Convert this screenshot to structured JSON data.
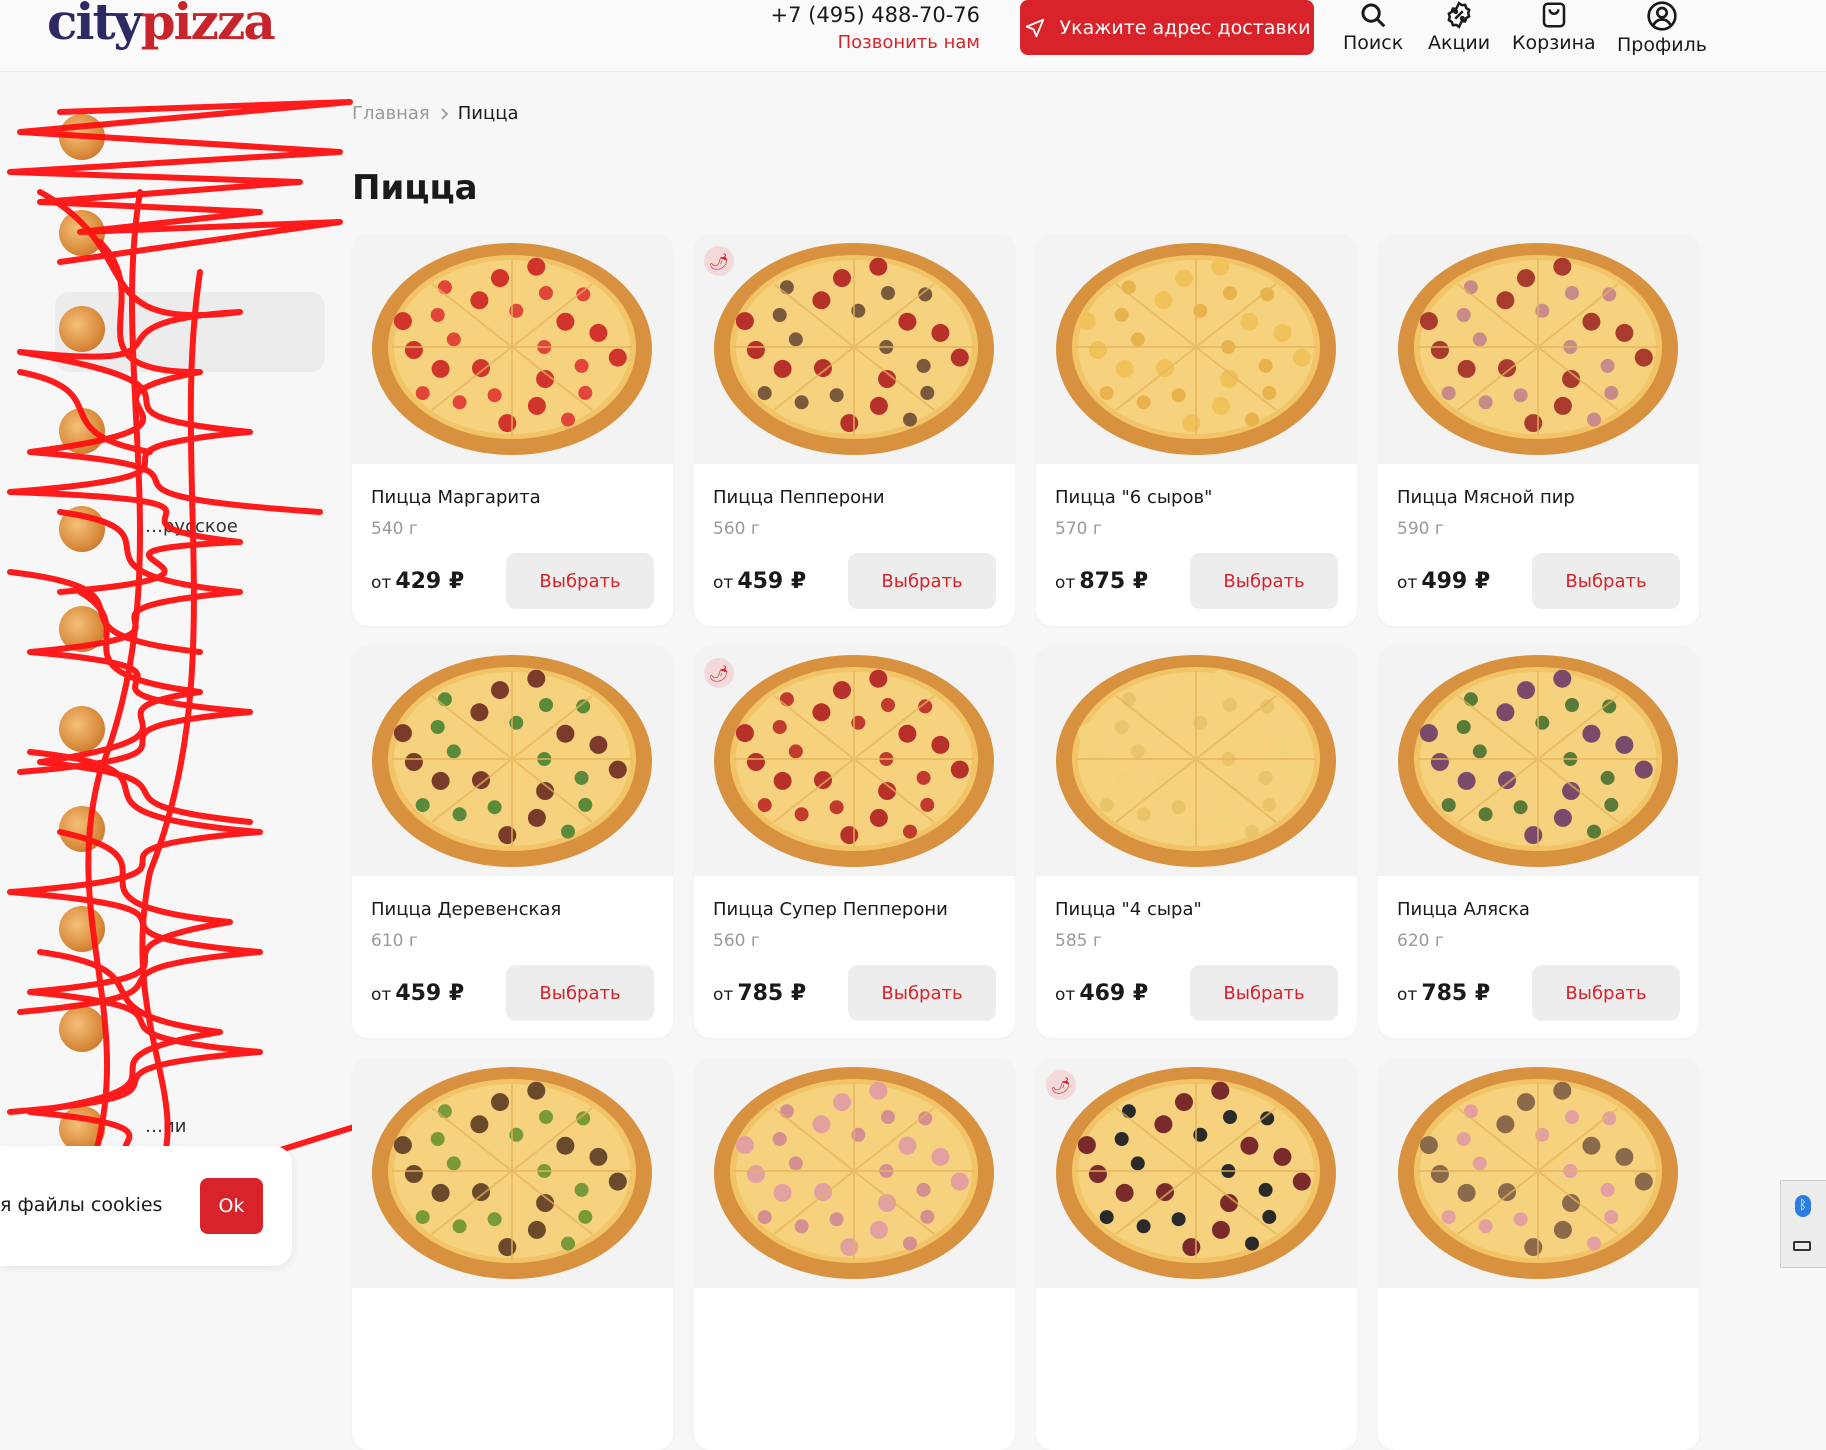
{
  "header": {
    "logo_part1": "city",
    "logo_part2": "pizza",
    "phone": "+7 (495) 488-70-76",
    "call_label": "Позвонить нам",
    "address_button": "Укажите адрес доставки",
    "nav": {
      "search": "Поиск",
      "promo": "Акции",
      "cart": "Корзина",
      "profile": "Профиль"
    }
  },
  "sidebar": {
    "items": [
      {
        "label": ""
      },
      {
        "label": ""
      },
      {
        "label": ""
      },
      {
        "label": ""
      },
      {
        "label": "…русское"
      },
      {
        "label": ""
      },
      {
        "label": ""
      },
      {
        "label": ""
      },
      {
        "label": ""
      },
      {
        "label": ""
      },
      {
        "label": "…ии"
      }
    ]
  },
  "breadcrumb": {
    "home": "Главная",
    "current": "Пицца"
  },
  "page_title": "Пицца",
  "price_prefix": "от",
  "choose_label": "Выбрать",
  "products": [
    {
      "name": "Пицца Маргарита",
      "weight": "540 г",
      "price": "429 ₽",
      "spicy": false
    },
    {
      "name": "Пицца Пепперони",
      "weight": "560 г",
      "price": "459 ₽",
      "spicy": true
    },
    {
      "name": "Пицца \"6 сыров\"",
      "weight": "570 г",
      "price": "875 ₽",
      "spicy": false
    },
    {
      "name": "Пицца Мясной пир",
      "weight": "590 г",
      "price": "499 ₽",
      "spicy": false
    },
    {
      "name": "Пицца Деревенская",
      "weight": "610 г",
      "price": "459 ₽",
      "spicy": false
    },
    {
      "name": "Пицца Супер Пепперони",
      "weight": "560 г",
      "price": "785 ₽",
      "spicy": true
    },
    {
      "name": "Пицца \"4 сыра\"",
      "weight": "585 г",
      "price": "469 ₽",
      "spicy": false
    },
    {
      "name": "Пицца Аляска",
      "weight": "620 г",
      "price": "785 ₽",
      "spicy": false
    },
    {
      "name": "",
      "weight": "",
      "price": "",
      "spicy": false
    },
    {
      "name": "",
      "weight": "",
      "price": "",
      "spicy": false
    },
    {
      "name": "",
      "weight": "",
      "price": "",
      "spicy": true
    },
    {
      "name": "",
      "weight": "",
      "price": "",
      "spicy": false
    }
  ],
  "cookie": {
    "text": "я файлы cookies",
    "ok": "Ok"
  },
  "colors": {
    "brand_red": "#d8232a",
    "logo_blue": "#2d2a63"
  }
}
